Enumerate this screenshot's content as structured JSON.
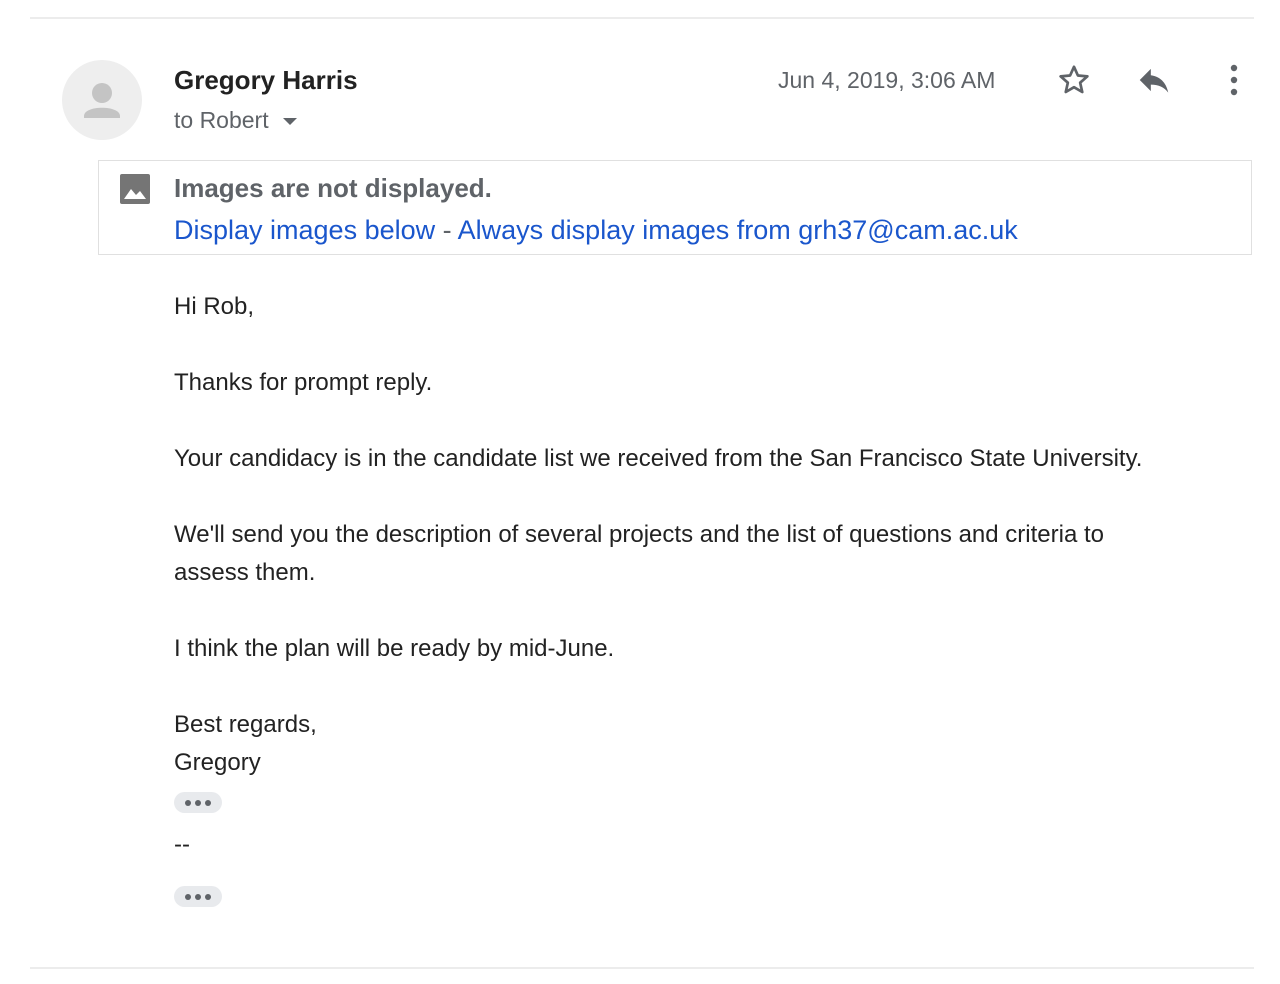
{
  "message": {
    "sender_name": "Gregory Harris",
    "recipient_label": "to Robert",
    "date": "Jun 4, 2019, 3:06 AM",
    "icons": {
      "avatar": "person-icon",
      "star": "star-outline-icon",
      "reply": "reply-icon",
      "more": "more-vert-icon",
      "recipient_dropdown": "caret-down-icon"
    }
  },
  "image_banner": {
    "title": "Images are not displayed.",
    "display_below_link": "Display images below",
    "separator": " - ",
    "always_display_link": "Always display images from grh37@cam.ac.uk",
    "icon": "image-icon"
  },
  "body": {
    "greeting": "Hi Rob,",
    "line1": "Thanks for prompt reply.",
    "line2": "Your candidacy is in the candidate list we received from the San Francisco State University.",
    "line3a": "We'll send you the description of several projects and the list of questions and criteria to",
    "line3b": "assess them.",
    "line4": "I think the plan will be ready by mid-June.",
    "signoff": "Best regards,",
    "signature": "Gregory",
    "sig_separator": "--"
  },
  "colors": {
    "link": "#1a56cc",
    "secondary_text": "#5f6368",
    "primary_text": "#222222",
    "divider": "#ececec"
  }
}
